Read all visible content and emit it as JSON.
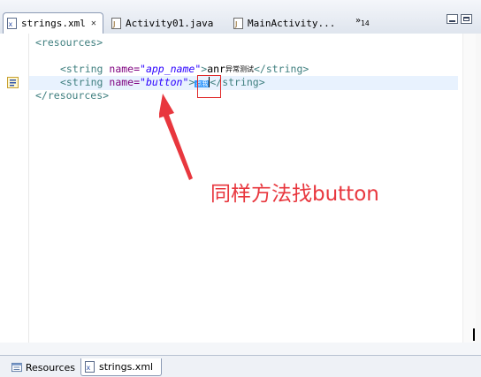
{
  "tabs": [
    {
      "label": "strings.xml",
      "close": "✕"
    },
    {
      "label": "Activity01.java"
    },
    {
      "label": "MainActivity..."
    }
  ],
  "overflow": {
    "symbol": "»",
    "count": "14"
  },
  "code": {
    "line1": "<resources>",
    "line2": {
      "open": "<string ",
      "attr": "name=",
      "value": "\"app_name\"",
      "close": ">",
      "text": "anr",
      "cjk": "异常测试",
      "end": "</string>"
    },
    "line3": {
      "open": "<string ",
      "attr": "name=",
      "value": "\"button\"",
      "close": ">",
      "selected": "点我",
      "end": "</string>"
    },
    "line4": "</resources>"
  },
  "annotation": "同样方法找button",
  "bottom_tabs": [
    {
      "label": "Resources"
    },
    {
      "label": "strings.xml"
    }
  ],
  "colors": {
    "annotation": "#e8373e",
    "tag": "#3f7f7f",
    "attr": "#7f007f",
    "value": "#2a00ff"
  }
}
